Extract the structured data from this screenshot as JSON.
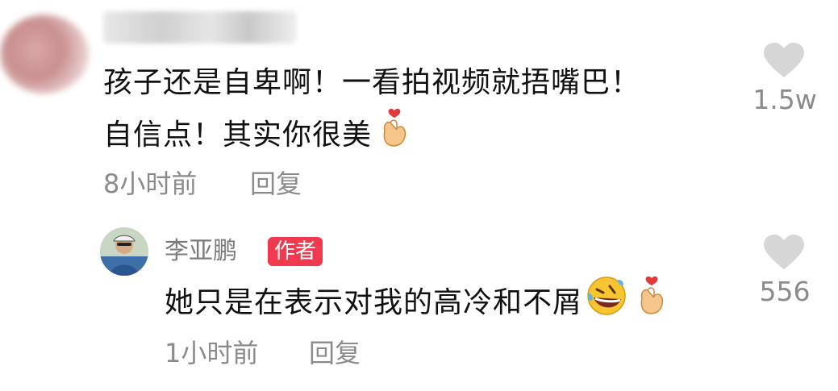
{
  "top_comment": {
    "username": "帽子",
    "text_line1": "孩子还是自卑啊！一看拍视频就捂嘴巴！",
    "text_line2": "自信点！其实你很美",
    "time": "8小时前",
    "reply_label": "回复",
    "like_count": "1.5w",
    "emoji": "finger-heart-emoji"
  },
  "reply_comment": {
    "username": "李亚鹏",
    "badge": "作者",
    "text": "她只是在表示对我的高冷和不屑",
    "time": "1小时前",
    "reply_label": "回复",
    "like_count": "556",
    "emojis": [
      "rolling-laughing-emoji",
      "finger-heart-emoji"
    ]
  },
  "colors": {
    "text": "#111111",
    "meta": "#8b8b8b",
    "heart": "#d6d6d6",
    "badge": "#f0394f"
  }
}
